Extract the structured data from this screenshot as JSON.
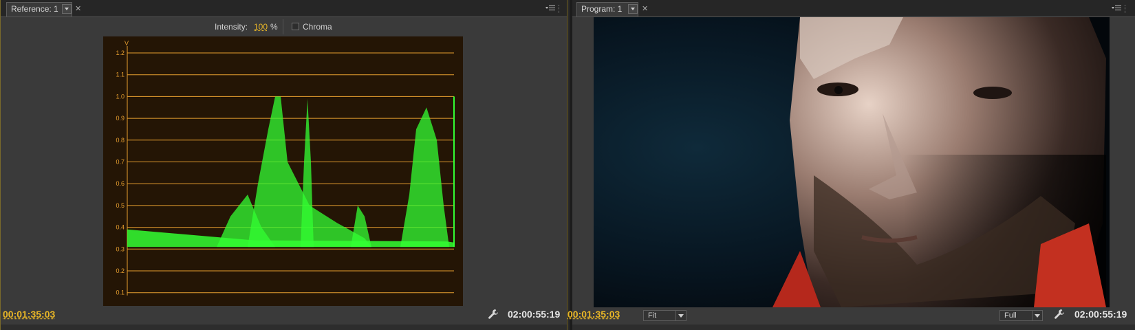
{
  "reference_panel": {
    "tab_label": "Reference: 1",
    "intensity_label": "Intensity:",
    "intensity_value": "100",
    "intensity_unit": "%",
    "chroma_label": "Chroma",
    "chroma_checked": false,
    "current_time": "00:01:35:03",
    "duration": "02:00:55:19"
  },
  "program_panel": {
    "tab_label": "Program: 1",
    "zoom_select": "Fit",
    "resolution_select": "Full",
    "current_time": "00:01:35:03",
    "duration": "02:00:55:19"
  },
  "waveform": {
    "unit_label": "V",
    "ticks": [
      "1.2",
      "1.1",
      "1.0",
      "0.9",
      "0.8",
      "0.7",
      "0.6",
      "0.5",
      "0.4",
      "0.3",
      "0.2",
      "0.1"
    ],
    "trace_color": "#33ff33",
    "grid_color": "#e8a030"
  },
  "colors": {
    "accent_timecode": "#e8b627",
    "panel_bg": "#3a3a3a"
  },
  "icons": {
    "wrench": "wrench-icon",
    "panel_menu": "panel-menu-icon",
    "close": "close-icon"
  }
}
